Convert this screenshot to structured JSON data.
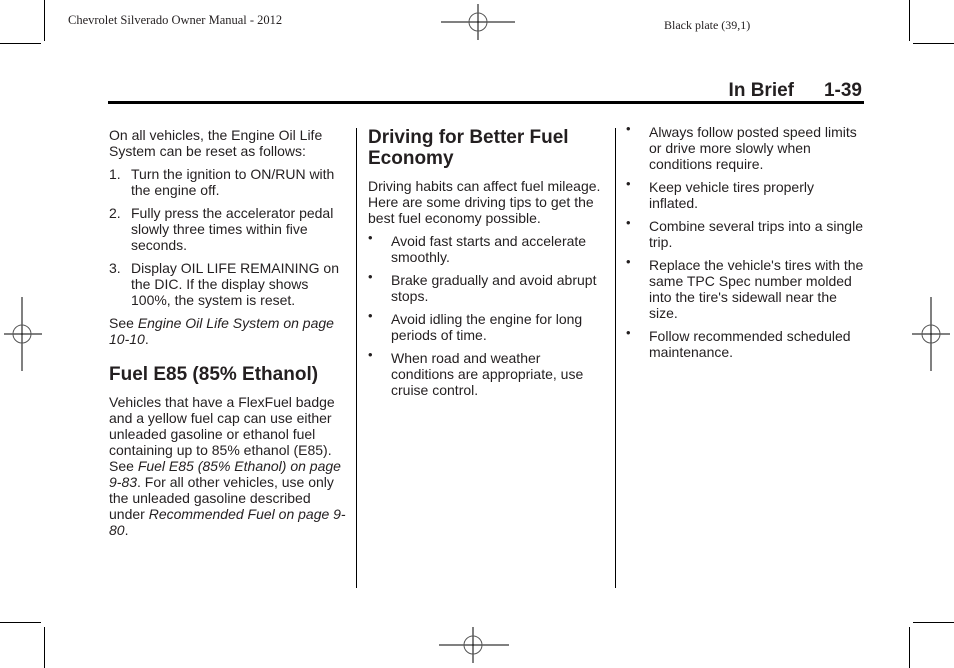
{
  "print_marks": {
    "plate_left": "Chevrolet Silverado Owner Manual - 2012",
    "plate_right": "Black plate (39,1)"
  },
  "header": {
    "section_title": "In Brief",
    "page_number": "1-39"
  },
  "left_column": {
    "intro": "On all vehicles, the Engine Oil Life System can be reset as follows:",
    "steps": [
      {
        "num": "1.",
        "text": "Turn the ignition to ON/RUN with the engine off."
      },
      {
        "num": "2.",
        "text": "Fully press the accelerator pedal slowly three times within five seconds."
      },
      {
        "num": "3.",
        "text": "Display OIL LIFE REMAINING on the DIC. If the display shows 100%, the system is reset."
      }
    ],
    "see_prefix": "See ",
    "see_link": "Engine Oil Life System on page 10-10",
    "see_suffix": ".",
    "fuel_heading": "Fuel E85 (85% Ethanol)",
    "fuel_para_1": "Vehicles that have a FlexFuel badge and a yellow fuel cap can use either unleaded gasoline or ethanol fuel containing up to 85% ethanol (E85). See ",
    "fuel_link_1": "Fuel E85 (85% Ethanol) on page 9-83",
    "fuel_para_2": ". For all other vehicles, use only the unleaded gasoline described under ",
    "fuel_link_2": "Recommended Fuel on page 9-80",
    "fuel_para_3": "."
  },
  "middle_column": {
    "heading": "Driving for Better Fuel Economy",
    "intro": "Driving habits can affect fuel mileage. Here are some driving tips to get the best fuel economy possible.",
    "bullet_glyph": "•",
    "tips": [
      "Avoid fast starts and accelerate smoothly.",
      "Brake gradually and avoid abrupt stops.",
      "Avoid idling the engine for long periods of time.",
      "When road and weather conditions are appropriate, use cruise control."
    ]
  },
  "right_column": {
    "bullet_glyph": "•",
    "tips": [
      "Always follow posted speed limits or drive more slowly when conditions require.",
      "Keep vehicle tires properly inflated.",
      "Combine several trips into a single trip.",
      "Replace the vehicle's tires with the same TPC Spec number molded into the tire's sidewall near the size.",
      "Follow recommended scheduled maintenance."
    ]
  }
}
